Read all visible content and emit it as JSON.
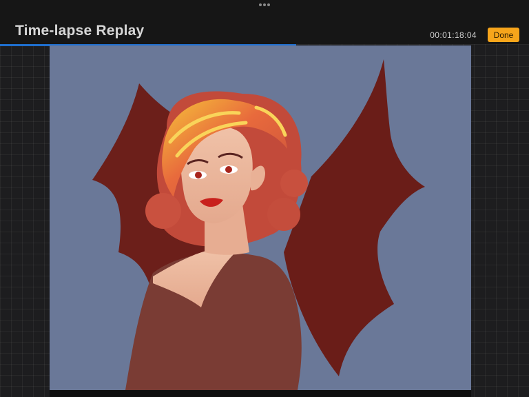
{
  "header": {
    "title": "Time-lapse Replay",
    "timer": "00:01:18:04",
    "done_label": "Done",
    "more_icon": "more-dots-icon"
  },
  "playback": {
    "progress": 0.56,
    "accent_color": "#1f6fd0"
  },
  "canvas": {
    "background_color": "#6a7898",
    "content": "artwork"
  },
  "colors": {
    "done_button": "#f7a51b"
  }
}
